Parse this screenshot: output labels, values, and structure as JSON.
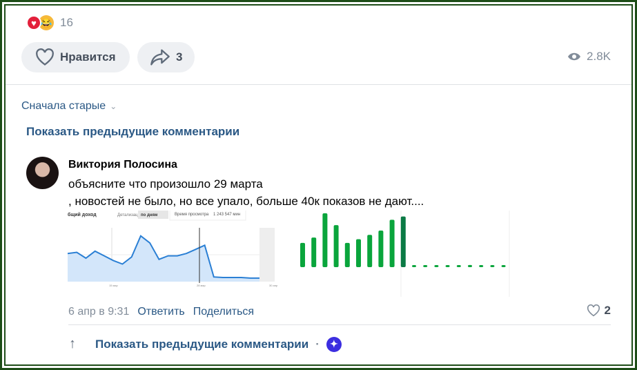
{
  "post": {
    "reaction_count": "16",
    "like_label": "Нравится",
    "share_count": "3",
    "views": "2.8K"
  },
  "comments": {
    "sort_label": "Сначала старые",
    "show_previous": "Показать предыдущие комментарии",
    "items": [
      {
        "author": "Виктория Полосина",
        "text_line1": "объясните что произошло 29 марта",
        "text_line2": ", новостей не было, но все упало, больше 40к показов не дают....",
        "date": "6 апр в 9:31",
        "reply": "Ответить",
        "share": "Поделиться",
        "likes": "2",
        "attachment": {
          "metric_label": "бщий доход",
          "detail_label": "Детализация",
          "detail_value": "по дням",
          "tooltip_label": "Время просмотра",
          "tooltip_value": "1 243 547 мин",
          "x_ticks": [
            "15 мар",
            "28 мар",
            "30 апр"
          ],
          "line_values": [
            48,
            50,
            40,
            52,
            44,
            36,
            30,
            42,
            78,
            66,
            38,
            44,
            44,
            48,
            55,
            62,
            8,
            7,
            7,
            7,
            6,
            6
          ],
          "bar_values": [
            45,
            55,
            100,
            78,
            45,
            52,
            60,
            68,
            88,
            94,
            3,
            3,
            3,
            3,
            3,
            4,
            3,
            3,
            3
          ]
        }
      }
    ]
  },
  "footer": {
    "show_previous": "Показать предыдущие комментарии",
    "separator": "·"
  },
  "colors": {
    "link": "#2a5885",
    "line": "#2a7fd4",
    "bar": "#0aa53c"
  }
}
